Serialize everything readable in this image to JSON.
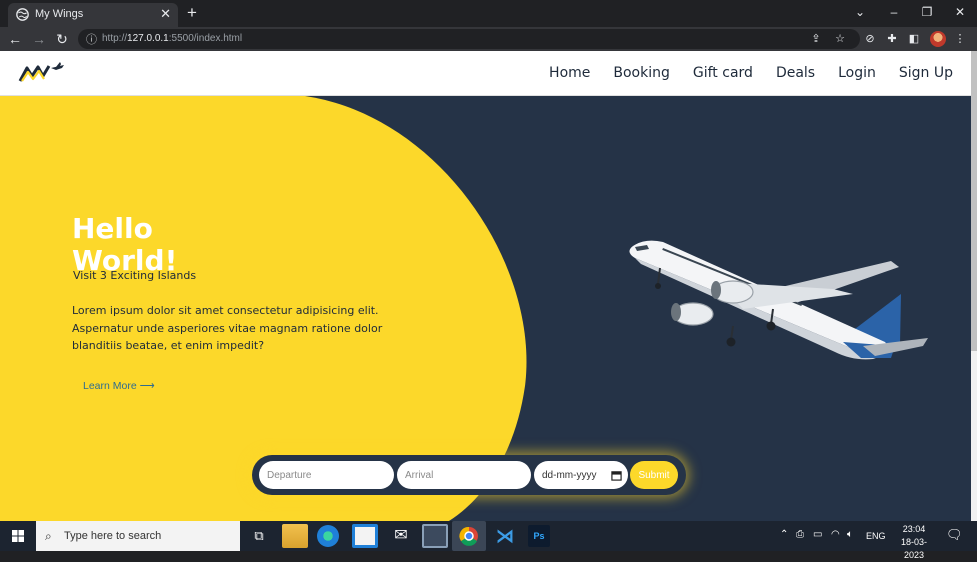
{
  "browser": {
    "tab_title": "My Wings",
    "new_tab": "+",
    "url_prefix": "http://",
    "url_host": "127.0.0.1",
    "url_rest": ":5500/index.html"
  },
  "site": {
    "nav": [
      "Home",
      "Booking",
      "Gift card",
      "Deals",
      "Login",
      "Sign Up"
    ],
    "hero": {
      "title_line1": "Hello",
      "title_line2": "World!",
      "subtitle": "Visit 3 Exciting Islands",
      "body": "Lorem ipsum dolor sit amet consectetur adipisicing elit. Aspernatur unde asperiores vitae magnam ratione dolor blanditiis beatae, et enim impedit?",
      "learn_more": "Learn More ⟶"
    },
    "search_form": {
      "departure_placeholder": "Departure",
      "arrival_placeholder": "Arrival",
      "date_placeholder": "dd-mm-yyyy",
      "submit_label": "Submit"
    },
    "colors": {
      "yellow": "#fcd82a",
      "navy": "#253347",
      "white": "#ffffff"
    }
  },
  "taskbar": {
    "search_placeholder": "Type here to search",
    "language": "ENG",
    "time": "23:04",
    "date": "18-03-2023"
  }
}
